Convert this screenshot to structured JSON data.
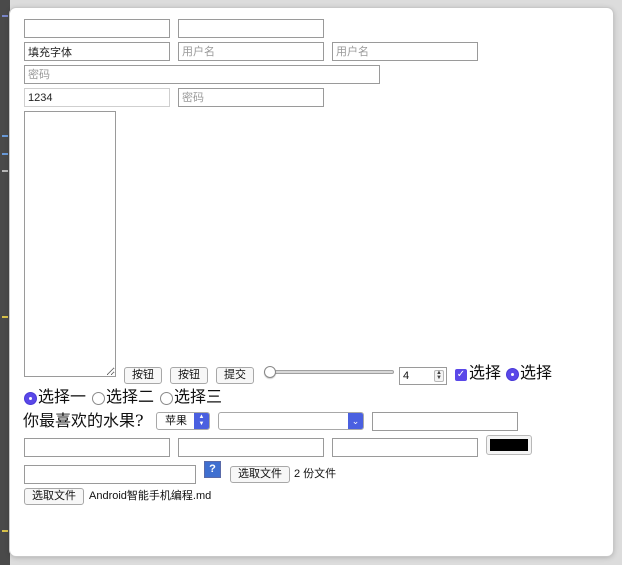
{
  "form": {
    "row1": {
      "input1_value": "",
      "input2_value": ""
    },
    "row2": {
      "text_value": "填充字体",
      "username_placeholder_1": "用户名",
      "username_placeholder_2": "用户名"
    },
    "password_wide_placeholder": "密码",
    "row4": {
      "number_value": "1234",
      "password_placeholder": "密码"
    },
    "textarea_value": "",
    "buttons": {
      "button1": "按钮",
      "button2": "按钮",
      "submit": "提交"
    },
    "range_level_percent": 0,
    "number_spinner_value": "4",
    "checkbox": {
      "checked": true,
      "label": "选择"
    },
    "radio_single": {
      "checked": true,
      "label": "选择"
    },
    "radio_group": [
      {
        "label": "选择一",
        "checked": true
      },
      {
        "label": "选择二",
        "checked": false
      },
      {
        "label": "选择三",
        "checked": false
      }
    ],
    "fruit_question": "你最喜欢的水果?",
    "fruit_select_value": "苹果",
    "empty_select_value": "",
    "color_value": "#000000",
    "file_multi_label": "选取文件",
    "file_multi_status": "2 份文件",
    "file_single_label": "选取文件",
    "file_single_name": "Android智能手机编程.md",
    "help_icon_glyph": "?"
  },
  "colors": {
    "accent": "#5a48e8",
    "select_blue": "#4a60e0"
  }
}
